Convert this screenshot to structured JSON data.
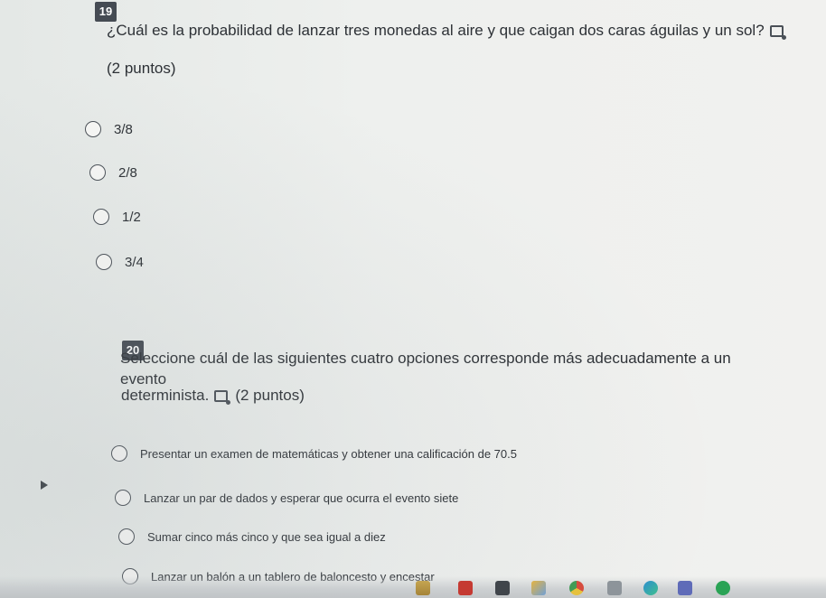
{
  "questions": [
    {
      "number": "19",
      "text": "¿Cuál es la probabilidad de lanzar tres monedas al aire y que caigan dos caras águilas y un sol?",
      "points": "(2 puntos)",
      "options": [
        "3/8",
        "2/8",
        "1/2",
        "3/4"
      ]
    },
    {
      "number": "20",
      "text_line1": "Seleccione cuál de las siguientes cuatro opciones corresponde más adecuadamente a un evento",
      "text_line2": "determinista.",
      "points": "(2 puntos)",
      "options": [
        "Presentar un examen de matemáticas y obtener una calificación de 70.5",
        "Lanzar un par de dados y esperar que ocurra el evento siete",
        "Sumar cinco más cinco y que sea igual a diez",
        "Lanzar un balón a un tablero de baloncesto y encestar"
      ]
    }
  ],
  "icons": {
    "immersive_reader": "immersive-reader-icon",
    "taskbar": [
      "file-explorer-icon",
      "youtube-icon",
      "calculator-icon",
      "paint-icon",
      "chrome-icon",
      "network-icon",
      "edge-icon",
      "teams-icon",
      "spotify-icon"
    ]
  },
  "colors": {
    "badge_bg": "#454b53",
    "text": "#2d3136",
    "radio_border": "#4a5057",
    "background": "#eef0ee"
  }
}
